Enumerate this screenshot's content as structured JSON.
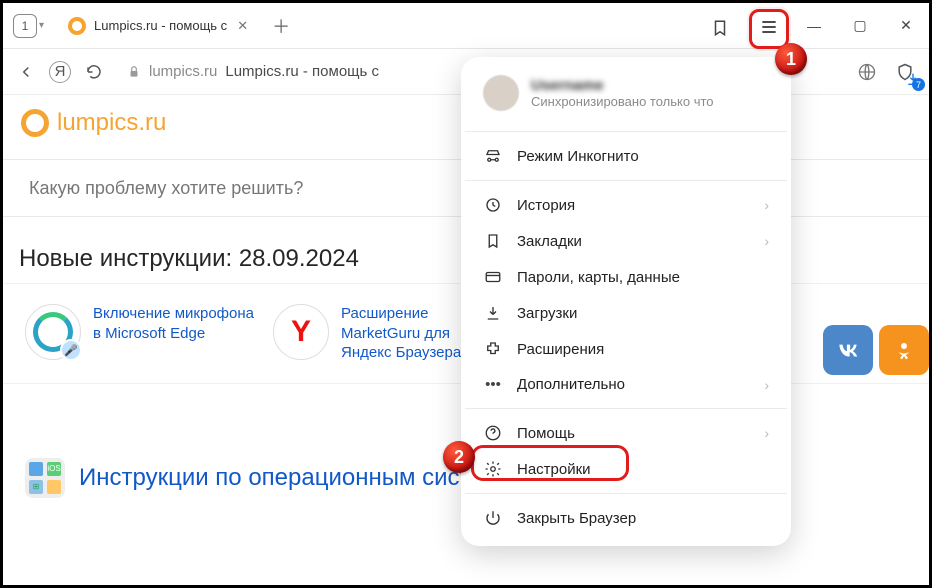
{
  "titlebar": {
    "tab_counter": "1",
    "tab_title": "Lumpics.ru - помощь с",
    "bookmark_icon": "bookmark"
  },
  "addrbar": {
    "host": "lumpics.ru",
    "rest": "Lumpics.ru - помощь с",
    "download_badge": "7"
  },
  "page": {
    "logo_text": "lumpics.ru",
    "search_placeholder": "Какую проблему хотите решить?",
    "news_heading": "Новые инструкции: 28.09.2024",
    "article1": "Включение микрофона в Microsoft Edge",
    "article2": "Расширение MarketGuru для Яндекс Браузера",
    "category": "Инструкции по операционным системам"
  },
  "menu": {
    "acc_name": "Username",
    "acc_sub": "Синхронизировано только что",
    "items": [
      {
        "icon": "incognito",
        "label": "Режим Инкогнито",
        "chev": false
      },
      {
        "icon": "history",
        "label": "История",
        "chev": true
      },
      {
        "icon": "bookmarks",
        "label": "Закладки",
        "chev": true
      },
      {
        "icon": "passwords",
        "label": "Пароли, карты, данные",
        "chev": false
      },
      {
        "icon": "downloads",
        "label": "Загрузки",
        "chev": false
      },
      {
        "icon": "extensions",
        "label": "Расширения",
        "chev": false
      },
      {
        "icon": "more",
        "label": "Дополнительно",
        "chev": true
      },
      {
        "icon": "help",
        "label": "Помощь",
        "chev": true
      },
      {
        "icon": "settings",
        "label": "Настройки",
        "chev": false
      },
      {
        "icon": "close",
        "label": "Закрыть Браузер",
        "chev": false
      }
    ]
  },
  "callouts": {
    "b1": "1",
    "b2": "2"
  }
}
